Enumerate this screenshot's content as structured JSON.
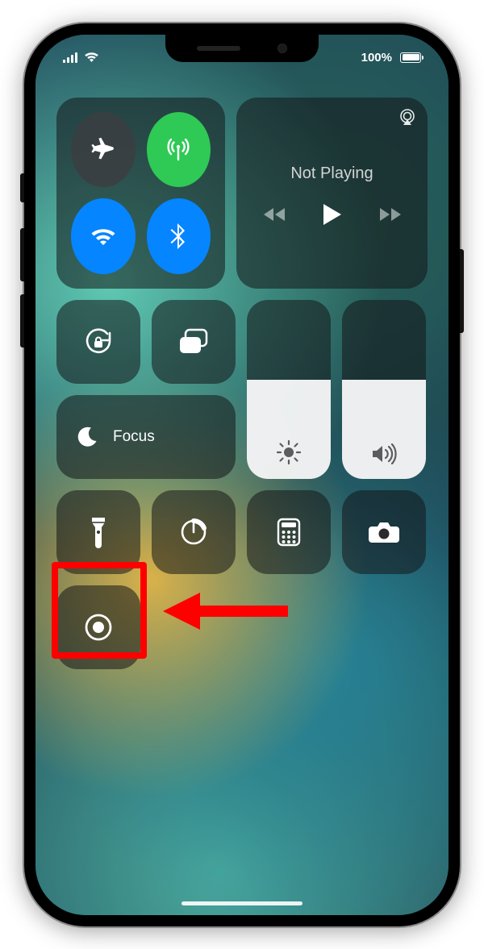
{
  "status_bar": {
    "battery_text": "100%"
  },
  "connectivity": {
    "airplane": {
      "on": false,
      "icon": "airplane-icon"
    },
    "cellular": {
      "on": true,
      "icon": "antenna-icon"
    },
    "wifi": {
      "on": true,
      "icon": "wifi-icon"
    },
    "bluetooth": {
      "on": true,
      "icon": "bluetooth-icon"
    }
  },
  "media": {
    "title": "Not Playing",
    "airplay_icon": "airplay-icon"
  },
  "controls": {
    "orientation_lock": "rotation-lock-icon",
    "screen_mirroring": "screen-mirroring-icon",
    "focus_label": "Focus",
    "focus_icon": "moon-icon"
  },
  "sliders": {
    "brightness_icon": "sun-icon",
    "volume_icon": "speaker-icon"
  },
  "quick": {
    "flashlight": "flashlight-icon",
    "timer": "timer-icon",
    "calculator": "calculator-icon",
    "camera": "camera-icon",
    "screen_record": "record-icon"
  },
  "annotation": {
    "highlight_target": "screen-recording-button",
    "arrow_color": "#ff0000"
  }
}
